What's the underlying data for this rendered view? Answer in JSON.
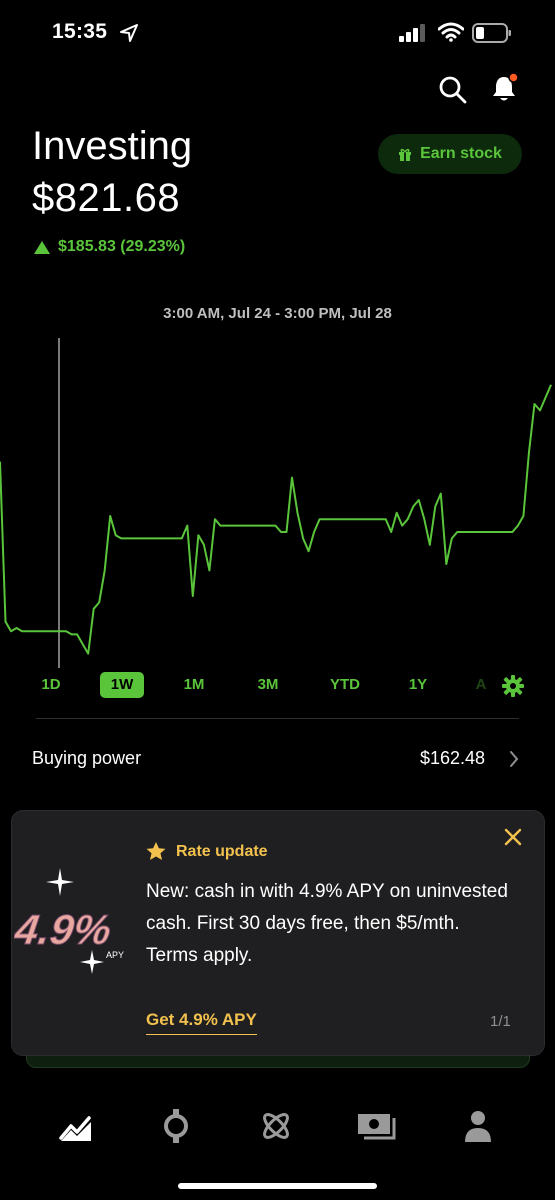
{
  "status_bar": {
    "time": "15:35"
  },
  "header": {
    "title": "Investing",
    "value": "$821.68",
    "change": "$185.83 (29.23%)",
    "earn_button": "Earn stock"
  },
  "chart": {
    "range_label": "3:00 AM, Jul 24 - 3:00 PM, Jul 28",
    "line_color": "#5ac53b"
  },
  "chart_data": {
    "type": "line",
    "title": "",
    "xlabel": "",
    "ylabel": "",
    "ylim": [
      0,
      100
    ],
    "x": [
      0,
      1,
      2,
      3,
      4,
      5,
      6,
      7,
      8,
      9,
      10,
      11,
      12,
      13,
      14,
      15,
      16,
      17,
      18,
      19,
      20,
      21,
      22,
      23,
      24,
      25,
      26,
      27,
      28,
      29,
      30,
      31,
      32,
      33,
      34,
      35,
      36,
      37,
      38,
      39,
      40,
      41,
      42,
      43,
      44,
      45,
      46,
      47,
      48,
      49,
      50,
      51,
      52,
      53,
      54,
      55,
      56,
      57,
      58,
      59,
      60,
      61,
      62,
      63,
      64,
      65,
      66,
      67,
      68,
      69,
      70,
      71,
      72,
      73,
      74,
      75,
      76,
      77,
      78,
      79,
      80,
      81,
      82,
      83,
      84,
      85,
      86,
      87,
      88,
      89,
      90,
      91,
      92,
      93,
      94,
      95,
      96,
      97,
      98,
      99,
      100
    ],
    "values": [
      62,
      12,
      9,
      10,
      9,
      9,
      9,
      9,
      9,
      9,
      9,
      9,
      9,
      8,
      8,
      5,
      2,
      16,
      18,
      28,
      45,
      39,
      38,
      38,
      38,
      38,
      38,
      38,
      38,
      38,
      38,
      38,
      38,
      38,
      42,
      20,
      39,
      36,
      28,
      44,
      42,
      42,
      42,
      42,
      42,
      42,
      42,
      42,
      42,
      42,
      42,
      40,
      40,
      57,
      46,
      38,
      34,
      40,
      44,
      44,
      44,
      44,
      44,
      44,
      44,
      44,
      44,
      44,
      44,
      44,
      44,
      40,
      46,
      42,
      44,
      48,
      50,
      44,
      36,
      48,
      52,
      30,
      38,
      40,
      40,
      40,
      40,
      40,
      40,
      40,
      40,
      40,
      40,
      40,
      42,
      45,
      65,
      80,
      78,
      82,
      86
    ]
  },
  "periods": [
    {
      "label": "1D"
    },
    {
      "label": "1W",
      "active": true
    },
    {
      "label": "1M"
    },
    {
      "label": "3M"
    },
    {
      "label": "YTD"
    },
    {
      "label": "1Y"
    },
    {
      "label": "A"
    }
  ],
  "buying_power": {
    "label": "Buying power",
    "value": "$162.48"
  },
  "promo": {
    "title": "Rate update",
    "body": "New: cash in with 4.9% APY on uninvested cash. First 30 days free, then $5/mth. Terms apply.",
    "cta": "Get 4.9% APY",
    "pager": "1/1",
    "badge_text": "4.9%",
    "badge_sub": "APY",
    "accent": "#f2c14e"
  },
  "tabbar": {
    "items": [
      {
        "icon": "chart-line-icon"
      },
      {
        "icon": "crypto-coin-icon"
      },
      {
        "icon": "atom-icon"
      },
      {
        "icon": "cash-icon"
      },
      {
        "icon": "profile-icon"
      }
    ]
  }
}
